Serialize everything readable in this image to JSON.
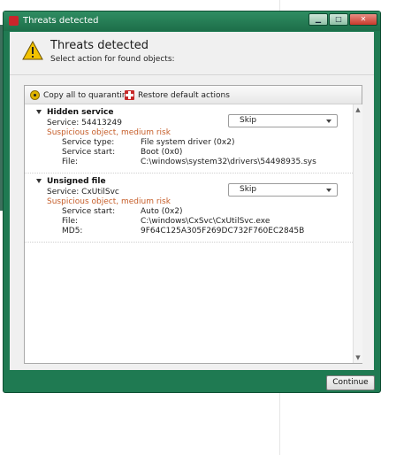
{
  "window": {
    "title": "Threats detected",
    "buttons": {
      "minimize": "▁",
      "maximize": "□",
      "close": "✕"
    }
  },
  "header": {
    "title": "Threats detected",
    "subtitle": "Select action for found objects:",
    "icon": "warning-icon"
  },
  "toolbar": {
    "copy_label": "Copy all to quarantine",
    "restore_label": "Restore default actions"
  },
  "threats": [
    {
      "title": "Hidden service",
      "service": "Service: 54413249",
      "risk": "Suspicious object, medium risk",
      "action": "Skip",
      "details": [
        {
          "key": "Service type:",
          "value": "File system driver (0x2)"
        },
        {
          "key": "Service start:",
          "value": "Boot (0x0)"
        },
        {
          "key": "File:",
          "value": "C:\\windows\\system32\\drivers\\54498935.sys"
        }
      ]
    },
    {
      "title": "Unsigned file",
      "service": "Service: CxUtilSvc",
      "risk": "Suspicious object, medium risk",
      "action": "Skip",
      "details": [
        {
          "key": "Service start:",
          "value": "Auto (0x2)"
        },
        {
          "key": "File:",
          "value": "C:\\windows\\CxSvc\\CxUtilSvc.exe"
        },
        {
          "key": "MD5:",
          "value": "9F64C125A305F269DC732F760EC2845B"
        }
      ]
    }
  ],
  "footer": {
    "continue_label": "Continue"
  },
  "colors": {
    "frame": "#1f7a52",
    "risk": "#c65e2a",
    "close": "#c8392b"
  }
}
